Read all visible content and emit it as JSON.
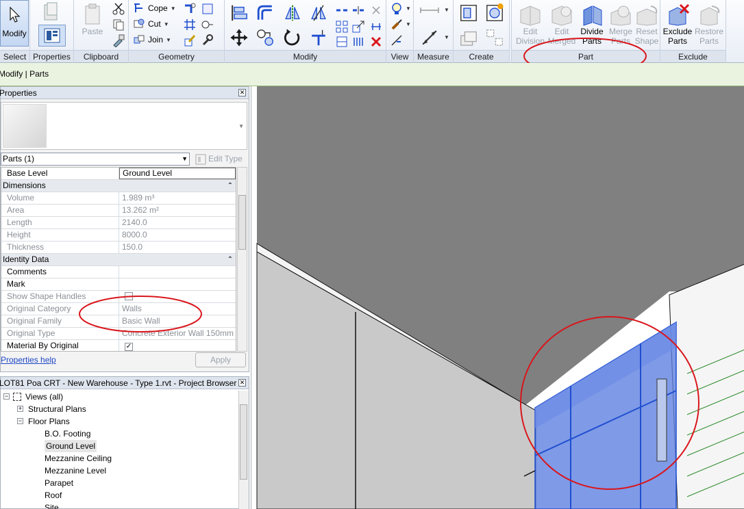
{
  "ribbon": {
    "panels": {
      "select": "Select",
      "properties": "Properties",
      "clipboard": "Clipboard",
      "geometry": "Geometry",
      "modify": "Modify",
      "view": "View",
      "measure": "Measure",
      "create": "Create",
      "part": "Part",
      "exclude": "Exclude"
    },
    "modify_label": "Modify",
    "paste_label": "Paste",
    "cope_label": "Cope",
    "cut_label": "Cut",
    "join_label": "Join",
    "part_buttons": {
      "edit_division_1": "Edit",
      "edit_division_2": "Division",
      "edit_merged_1": "Edit",
      "edit_merged_2": "Merged",
      "divide_parts_1": "Divide",
      "divide_parts_2": "Parts",
      "merge_parts_1": "Merge",
      "merge_parts_2": "Parts",
      "reset_shape_1": "Reset",
      "reset_shape_2": "Shape"
    },
    "exclude_buttons": {
      "exclude_parts_1": "Exclude",
      "exclude_parts_2": "Parts",
      "restore_parts_1": "Restore",
      "restore_parts_2": "Parts"
    }
  },
  "modebar": {
    "text": "Modify | Parts"
  },
  "properties": {
    "title": "Properties",
    "type_selector": "Parts (1)",
    "edit_type": "Edit Type",
    "rows": [
      {
        "kind": "param",
        "name": "Base Level",
        "value": "Ground Level",
        "readonly": false,
        "boxed": true
      },
      {
        "kind": "group",
        "name": "Dimensions"
      },
      {
        "kind": "param",
        "name": "Volume",
        "value": "1.989 m³",
        "readonly": true
      },
      {
        "kind": "param",
        "name": "Area",
        "value": "13.262 m²",
        "readonly": true
      },
      {
        "kind": "param",
        "name": "Length",
        "value": "2140.0",
        "readonly": true
      },
      {
        "kind": "param",
        "name": "Height",
        "value": "8000.0",
        "readonly": true
      },
      {
        "kind": "param",
        "name": "Thickness",
        "value": "150.0",
        "readonly": true
      },
      {
        "kind": "group",
        "name": "Identity Data"
      },
      {
        "kind": "param",
        "name": "Comments",
        "value": "",
        "readonly": false
      },
      {
        "kind": "param",
        "name": "Mark",
        "value": "",
        "readonly": false
      },
      {
        "kind": "check",
        "name": "Show Shape Handles",
        "checked": false,
        "readonly": true
      },
      {
        "kind": "param",
        "name": "Original Category",
        "value": "Walls",
        "readonly": true
      },
      {
        "kind": "param",
        "name": "Original Family",
        "value": "Basic Wall",
        "readonly": true
      },
      {
        "kind": "param",
        "name": "Original Type",
        "value": "Concrete Exterior Wall 150mm",
        "readonly": true
      },
      {
        "kind": "check",
        "name": "Material By Original",
        "checked": true,
        "readonly": false
      }
    ],
    "help_link": "Properties help",
    "apply": "Apply"
  },
  "browser": {
    "title": "LOT81 Poa CRT - New Warehouse - Type 1.rvt - Project Browser",
    "nodes": [
      {
        "label": "Views (all)",
        "level": 0,
        "expander": "−",
        "icon": true
      },
      {
        "label": "Structural Plans",
        "level": 1,
        "expander": "+"
      },
      {
        "label": "Floor Plans",
        "level": 1,
        "expander": "−"
      },
      {
        "label": "B.O. Footing",
        "level": 2
      },
      {
        "label": "Ground Level",
        "level": 2,
        "selected": true
      },
      {
        "label": "Mezzanine Ceiling",
        "level": 2
      },
      {
        "label": "Mezzanine Level",
        "level": 2
      },
      {
        "label": "Parapet",
        "level": 2
      },
      {
        "label": "Roof",
        "level": 2
      },
      {
        "label": "Site",
        "level": 2
      }
    ]
  },
  "colors": {
    "accent_blue": "#1f4fd0",
    "annotation_red": "#d9151b",
    "selection_fill": "#5b7de0",
    "roof_grey": "#808080"
  }
}
